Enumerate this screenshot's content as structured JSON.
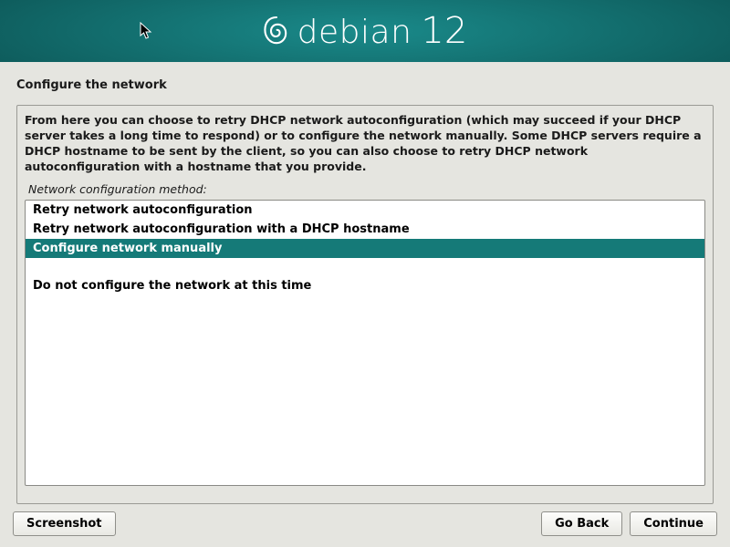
{
  "header": {
    "brand_name": "debian",
    "brand_version": "12"
  },
  "page": {
    "title": "Configure the network",
    "description": "From here you can choose to retry DHCP network autoconfiguration (which may succeed if your DHCP server takes a long time to respond) or to configure the network manually. Some DHCP servers require a DHCP hostname to be sent by the client, so you can also choose to retry DHCP network autoconfiguration with a hostname that you provide.",
    "prompt": "Network configuration method:",
    "options": [
      "Retry network autoconfiguration",
      "Retry network autoconfiguration with a DHCP hostname",
      "Configure network manually",
      "",
      "Do not configure the network at this time"
    ],
    "selected_index": 2
  },
  "buttons": {
    "screenshot": "Screenshot",
    "go_back": "Go Back",
    "continue": "Continue"
  }
}
